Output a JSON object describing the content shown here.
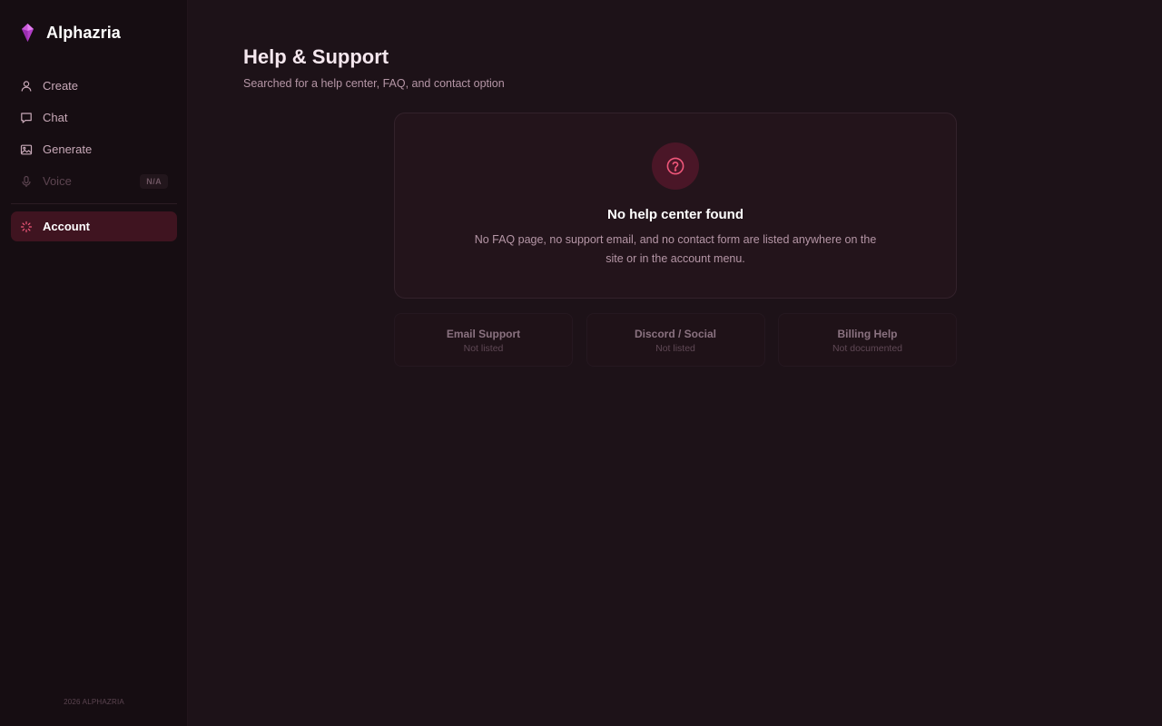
{
  "brand": {
    "name": "Alphazria",
    "accent": "#c64fd6"
  },
  "sidebar": {
    "items": [
      {
        "label": "Create",
        "icon": "user-icon",
        "state": "normal"
      },
      {
        "label": "Chat",
        "icon": "chat-bubble-icon",
        "state": "normal"
      },
      {
        "label": "Generate",
        "icon": "image-icon",
        "state": "normal"
      },
      {
        "label": "Voice",
        "icon": "microphone-icon",
        "state": "disabled",
        "badge": "N/A"
      }
    ],
    "account": {
      "label": "Account",
      "icon": "loading-spinner-icon",
      "state": "active"
    },
    "footer": "2026 ALPHAZRIA"
  },
  "main": {
    "title": "Help & Support",
    "subtitle": "Searched for a help center, FAQ, and contact option",
    "empty_state": {
      "icon": "help-circle-icon",
      "title": "No help center found",
      "description": "No FAQ page, no support email, and no contact form are listed anywhere on the site or in the account menu."
    },
    "options": [
      {
        "title": "Email Support",
        "status": "Not listed"
      },
      {
        "title": "Discord / Social",
        "status": "Not listed"
      },
      {
        "title": "Billing Help",
        "status": "Not documented"
      }
    ]
  },
  "colors": {
    "background": "#1d1218",
    "sidebar": "#160d12",
    "active_item": "#3f1420",
    "icon_accent": "#f0577a"
  }
}
